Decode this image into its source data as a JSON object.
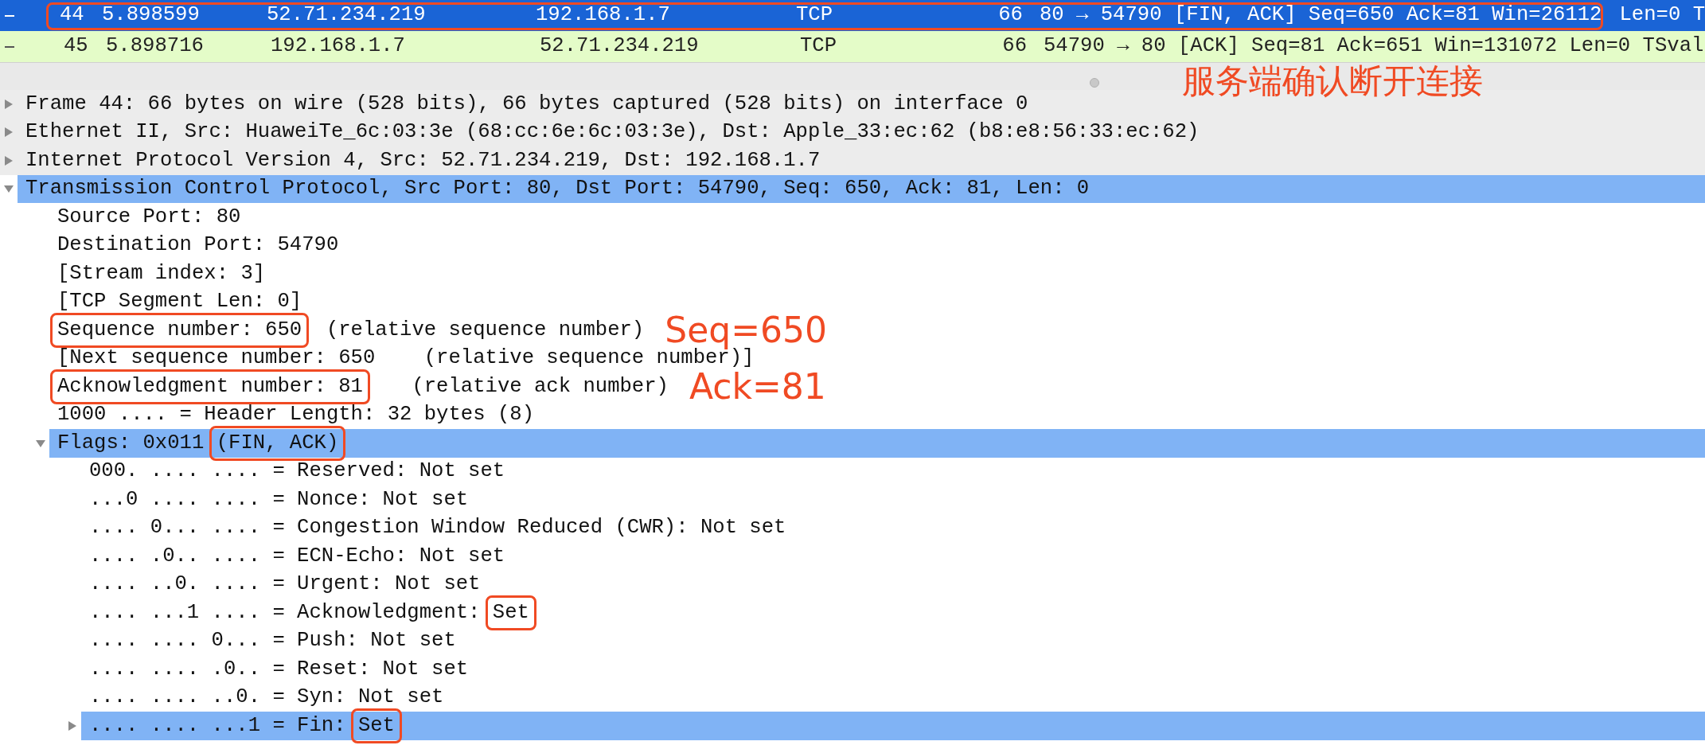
{
  "packets": [
    {
      "no": "44",
      "time": "5.898599",
      "source": "52.71.234.219",
      "destination": "192.168.1.7",
      "protocol": "TCP",
      "length": "66",
      "info": "80 → 54790 [FIN, ACK] Seq=650 Ack=81 Win=26112",
      "info_overflow": "Len=0 T",
      "selected": true,
      "outlined": true
    },
    {
      "no": "45",
      "time": "5.898716",
      "source": "192.168.1.7",
      "destination": "52.71.234.219",
      "protocol": "TCP",
      "length": "66",
      "info": "54790 → 80 [ACK] Seq=81 Ack=651 Win=131072 Len=0 TSval",
      "selected": false,
      "outlined": false
    }
  ],
  "callout": "服务端确认断开连接",
  "tree": [
    {
      "kind": "branch",
      "expanded": false,
      "selected": false,
      "text": "Frame 44: 66 bytes on wire (528 bits), 66 bytes captured (528 bits) on interface 0"
    },
    {
      "kind": "branch",
      "expanded": false,
      "selected": false,
      "text": "Ethernet II, Src: HuaweiTe_6c:03:3e (68:cc:6e:6c:03:3e), Dst: Apple_33:ec:62 (b8:e8:56:33:ec:62)"
    },
    {
      "kind": "branch",
      "expanded": false,
      "selected": false,
      "text": "Internet Protocol Version 4, Src: 52.71.234.219, Dst: 192.168.1.7"
    },
    {
      "kind": "branch",
      "expanded": true,
      "selected": true,
      "text": "Transmission Control Protocol, Src Port: 80, Dst Port: 54790, Seq: 650, Ack: 81, Len: 0",
      "children": [
        {
          "kind": "leaf",
          "selected": false,
          "text": "Source Port: 80"
        },
        {
          "kind": "leaf",
          "selected": false,
          "text": "Destination Port: 54790"
        },
        {
          "kind": "leaf",
          "selected": false,
          "text": "[Stream index: 3]"
        },
        {
          "kind": "leaf",
          "selected": false,
          "text": "[TCP Segment Len: 0]"
        },
        {
          "kind": "leaf",
          "selected": false,
          "segments": [
            {
              "text": "Sequence number: 650",
              "boxed": true
            },
            {
              "text": "  (relative sequence number)",
              "boxed": false
            }
          ],
          "note": "Seq=650"
        },
        {
          "kind": "leaf",
          "selected": false,
          "text": "[Next sequence number: 650    (relative sequence number)]"
        },
        {
          "kind": "leaf",
          "selected": false,
          "segments": [
            {
              "text": "Acknowledgment number: 81",
              "boxed": true
            },
            {
              "text": "    (relative ack number)",
              "boxed": false
            }
          ],
          "note": "Ack=81"
        },
        {
          "kind": "leaf",
          "selected": false,
          "text": "1000 .... = Header Length: 32 bytes (8)"
        },
        {
          "kind": "branch",
          "expanded": true,
          "selected": true,
          "segments": [
            {
              "text": "Flags: 0x011 ",
              "boxed": false
            },
            {
              "text": "(FIN, ACK)",
              "boxed": true
            }
          ],
          "children": [
            {
              "kind": "leaf",
              "selected": false,
              "text": "000. .... .... = Reserved: Not set"
            },
            {
              "kind": "leaf",
              "selected": false,
              "text": "...0 .... .... = Nonce: Not set"
            },
            {
              "kind": "leaf",
              "selected": false,
              "text": ".... 0... .... = Congestion Window Reduced (CWR): Not set"
            },
            {
              "kind": "leaf",
              "selected": false,
              "text": ".... .0.. .... = ECN-Echo: Not set"
            },
            {
              "kind": "leaf",
              "selected": false,
              "text": ".... ..0. .... = Urgent: Not set"
            },
            {
              "kind": "leaf",
              "selected": false,
              "segments": [
                {
                  "text": ".... ...1 .... = Acknowledgment: ",
                  "boxed": false
                },
                {
                  "text": "Set",
                  "boxed": true
                }
              ]
            },
            {
              "kind": "leaf",
              "selected": false,
              "text": ".... .... 0... = Push: Not set"
            },
            {
              "kind": "leaf",
              "selected": false,
              "text": ".... .... .0.. = Reset: Not set"
            },
            {
              "kind": "leaf",
              "selected": false,
              "text": ".... .... ..0. = Syn: Not set"
            },
            {
              "kind": "branch",
              "expanded": false,
              "selected": true,
              "segments": [
                {
                  "text": ".... .... ...1 = Fin: ",
                  "boxed": false
                },
                {
                  "text": "Set",
                  "boxed": true
                }
              ]
            }
          ]
        }
      ]
    }
  ]
}
